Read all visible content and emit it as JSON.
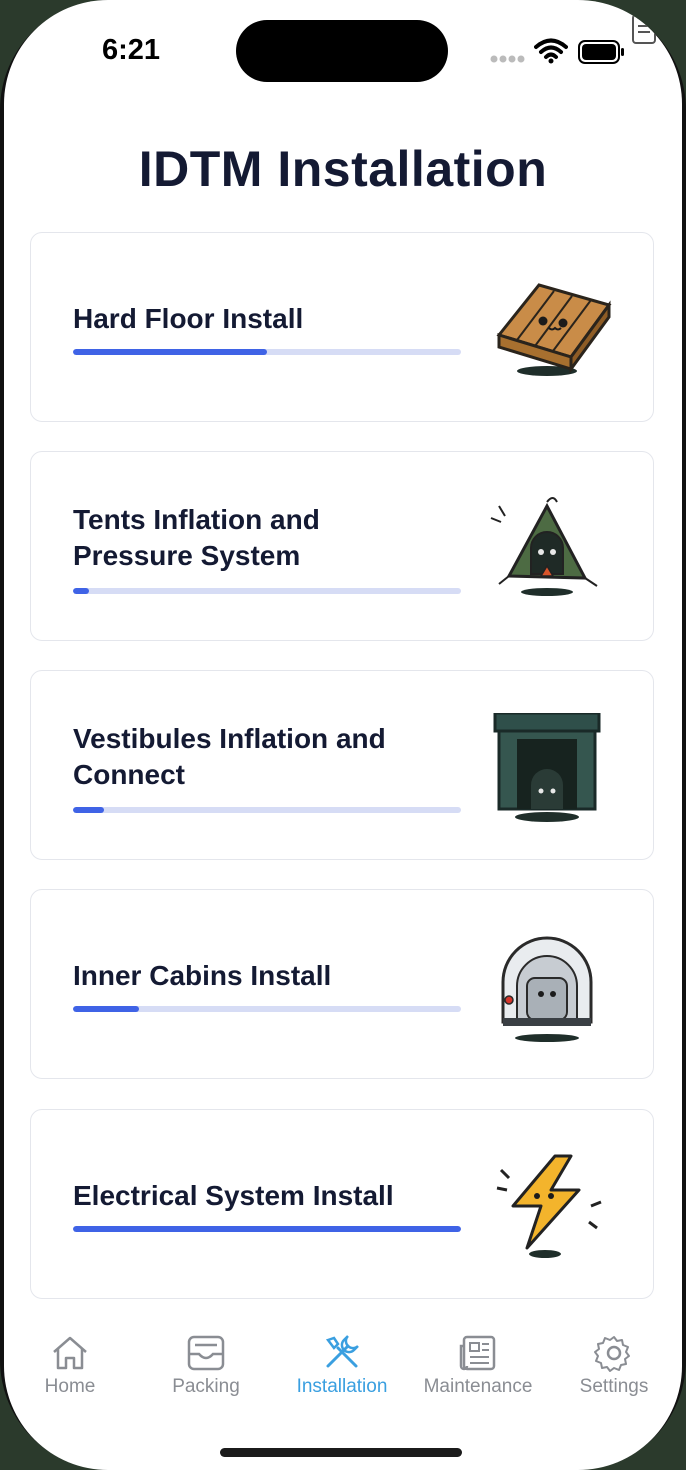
{
  "status_bar": {
    "time": "6:21"
  },
  "page": {
    "title": "IDTM Installation"
  },
  "cards": [
    {
      "title_line1": "Hard Floor Install",
      "title_line2": "",
      "progress": 0.5,
      "art": "wooden-floor-icon"
    },
    {
      "title_line1": "Tents Inflation and",
      "title_line2": "Pressure System",
      "progress": 0.04,
      "art": "tent-icon"
    },
    {
      "title_line1": "Vestibules Inflation and",
      "title_line2": "Connect",
      "progress": 0.08,
      "art": "vestibule-icon"
    },
    {
      "title_line1": "Inner Cabins Install",
      "title_line2": "",
      "progress": 0.17,
      "art": "cabin-icon"
    },
    {
      "title_line1": "Electrical System Install",
      "title_line2": "",
      "progress": 1.0,
      "art": "lightning-icon"
    }
  ],
  "tabbar": {
    "items": [
      {
        "label": "Home",
        "icon": "home-icon"
      },
      {
        "label": "Packing",
        "icon": "inbox-icon"
      },
      {
        "label": "Installation",
        "icon": "tools-icon",
        "active": true
      },
      {
        "label": "Maintenance",
        "icon": "newspaper-icon"
      },
      {
        "label": "Settings",
        "icon": "gear-icon"
      }
    ]
  },
  "colors": {
    "accent": "#3f63e6",
    "track": "#d6dcf5",
    "active_tab": "#3a9fe0",
    "inactive_tab": "#8a8d93",
    "title_text": "#141a33"
  }
}
